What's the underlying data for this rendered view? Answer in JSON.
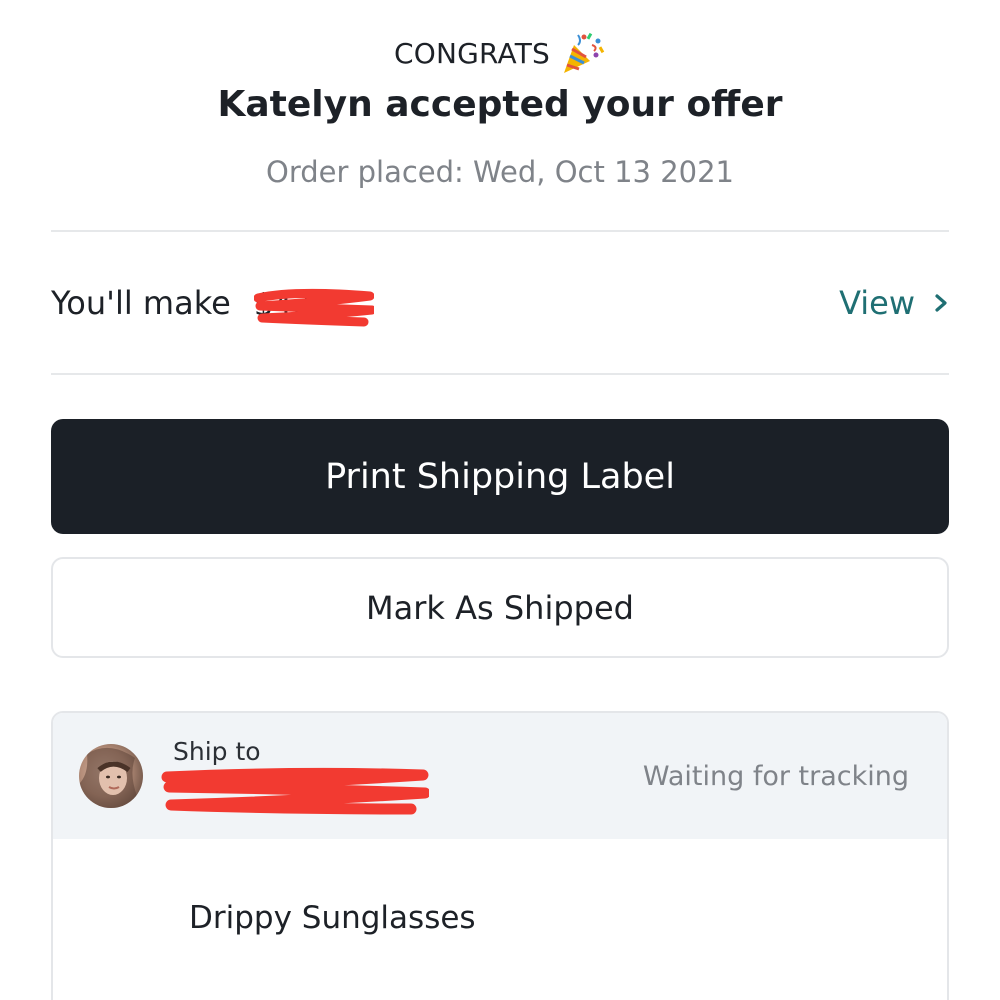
{
  "header": {
    "congrats": "CONGRATS",
    "headline": "Katelyn accepted your offer",
    "order_date": "Order placed: Wed, Oct 13 2021"
  },
  "earnings": {
    "label": "You'll make",
    "amount": "$4.55",
    "amount_redacted": true,
    "view_label": "View",
    "view_color": "#1f6f73"
  },
  "actions": {
    "print_label": "Print Shipping Label",
    "mark_shipped": "Mark As Shipped",
    "primary_color": "#1b2027"
  },
  "shipment": {
    "ship_to_label": "Ship to",
    "recipient_redacted": true,
    "status": "Waiting for tracking",
    "item_name": "Drippy Sunglasses"
  },
  "colors": {
    "redaction": "#f23a31",
    "card_header_bg": "#f1f4f7",
    "muted_text": "#7f8389"
  },
  "icons": {
    "celebration": "party-popper-icon",
    "view_arrow": "chevron-right-icon"
  }
}
